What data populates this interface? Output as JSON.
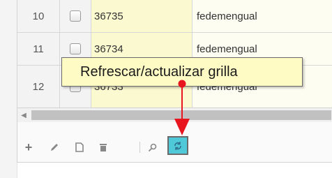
{
  "grid": {
    "rows": [
      {
        "num": "10",
        "id": "36735",
        "user": "fedemengual"
      },
      {
        "num": "11",
        "id": "36734",
        "user": "fedemengual"
      },
      {
        "num": "12",
        "id": "36733",
        "user": "fedemengual"
      }
    ]
  },
  "tooltip": {
    "text": "Refrescar/actualizar grilla"
  },
  "toolbar": {
    "icons": [
      "add-icon",
      "edit-icon",
      "view-icon",
      "delete-icon",
      "search-icon",
      "refresh-icon"
    ]
  },
  "colors": {
    "highlight": "#fbf9cf",
    "tooltip_bg": "#fffbc4",
    "refresh_bg": "#4fc9d8",
    "callout": "#e8141e"
  }
}
